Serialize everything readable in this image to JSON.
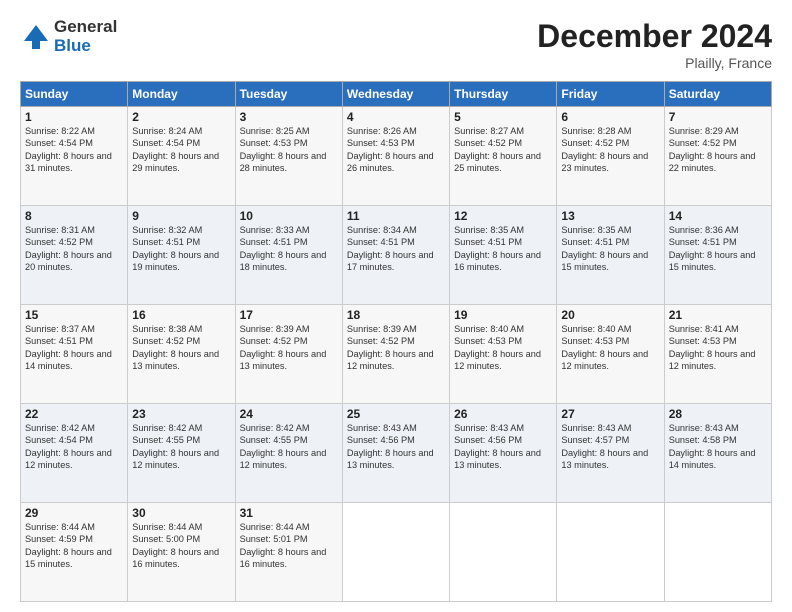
{
  "logo": {
    "general": "General",
    "blue": "Blue"
  },
  "title": "December 2024",
  "subtitle": "Plailly, France",
  "columns": [
    "Sunday",
    "Monday",
    "Tuesday",
    "Wednesday",
    "Thursday",
    "Friday",
    "Saturday"
  ],
  "weeks": [
    [
      {
        "day": "1",
        "rise": "Sunrise: 8:22 AM",
        "set": "Sunset: 4:54 PM",
        "daylight": "Daylight: 8 hours and 31 minutes."
      },
      {
        "day": "2",
        "rise": "Sunrise: 8:24 AM",
        "set": "Sunset: 4:54 PM",
        "daylight": "Daylight: 8 hours and 29 minutes."
      },
      {
        "day": "3",
        "rise": "Sunrise: 8:25 AM",
        "set": "Sunset: 4:53 PM",
        "daylight": "Daylight: 8 hours and 28 minutes."
      },
      {
        "day": "4",
        "rise": "Sunrise: 8:26 AM",
        "set": "Sunset: 4:53 PM",
        "daylight": "Daylight: 8 hours and 26 minutes."
      },
      {
        "day": "5",
        "rise": "Sunrise: 8:27 AM",
        "set": "Sunset: 4:52 PM",
        "daylight": "Daylight: 8 hours and 25 minutes."
      },
      {
        "day": "6",
        "rise": "Sunrise: 8:28 AM",
        "set": "Sunset: 4:52 PM",
        "daylight": "Daylight: 8 hours and 23 minutes."
      },
      {
        "day": "7",
        "rise": "Sunrise: 8:29 AM",
        "set": "Sunset: 4:52 PM",
        "daylight": "Daylight: 8 hours and 22 minutes."
      }
    ],
    [
      {
        "day": "8",
        "rise": "Sunrise: 8:31 AM",
        "set": "Sunset: 4:52 PM",
        "daylight": "Daylight: 8 hours and 20 minutes."
      },
      {
        "day": "9",
        "rise": "Sunrise: 8:32 AM",
        "set": "Sunset: 4:51 PM",
        "daylight": "Daylight: 8 hours and 19 minutes."
      },
      {
        "day": "10",
        "rise": "Sunrise: 8:33 AM",
        "set": "Sunset: 4:51 PM",
        "daylight": "Daylight: 8 hours and 18 minutes."
      },
      {
        "day": "11",
        "rise": "Sunrise: 8:34 AM",
        "set": "Sunset: 4:51 PM",
        "daylight": "Daylight: 8 hours and 17 minutes."
      },
      {
        "day": "12",
        "rise": "Sunrise: 8:35 AM",
        "set": "Sunset: 4:51 PM",
        "daylight": "Daylight: 8 hours and 16 minutes."
      },
      {
        "day": "13",
        "rise": "Sunrise: 8:35 AM",
        "set": "Sunset: 4:51 PM",
        "daylight": "Daylight: 8 hours and 15 minutes."
      },
      {
        "day": "14",
        "rise": "Sunrise: 8:36 AM",
        "set": "Sunset: 4:51 PM",
        "daylight": "Daylight: 8 hours and 15 minutes."
      }
    ],
    [
      {
        "day": "15",
        "rise": "Sunrise: 8:37 AM",
        "set": "Sunset: 4:51 PM",
        "daylight": "Daylight: 8 hours and 14 minutes."
      },
      {
        "day": "16",
        "rise": "Sunrise: 8:38 AM",
        "set": "Sunset: 4:52 PM",
        "daylight": "Daylight: 8 hours and 13 minutes."
      },
      {
        "day": "17",
        "rise": "Sunrise: 8:39 AM",
        "set": "Sunset: 4:52 PM",
        "daylight": "Daylight: 8 hours and 13 minutes."
      },
      {
        "day": "18",
        "rise": "Sunrise: 8:39 AM",
        "set": "Sunset: 4:52 PM",
        "daylight": "Daylight: 8 hours and 12 minutes."
      },
      {
        "day": "19",
        "rise": "Sunrise: 8:40 AM",
        "set": "Sunset: 4:53 PM",
        "daylight": "Daylight: 8 hours and 12 minutes."
      },
      {
        "day": "20",
        "rise": "Sunrise: 8:40 AM",
        "set": "Sunset: 4:53 PM",
        "daylight": "Daylight: 8 hours and 12 minutes."
      },
      {
        "day": "21",
        "rise": "Sunrise: 8:41 AM",
        "set": "Sunset: 4:53 PM",
        "daylight": "Daylight: 8 hours and 12 minutes."
      }
    ],
    [
      {
        "day": "22",
        "rise": "Sunrise: 8:42 AM",
        "set": "Sunset: 4:54 PM",
        "daylight": "Daylight: 8 hours and 12 minutes."
      },
      {
        "day": "23",
        "rise": "Sunrise: 8:42 AM",
        "set": "Sunset: 4:55 PM",
        "daylight": "Daylight: 8 hours and 12 minutes."
      },
      {
        "day": "24",
        "rise": "Sunrise: 8:42 AM",
        "set": "Sunset: 4:55 PM",
        "daylight": "Daylight: 8 hours and 12 minutes."
      },
      {
        "day": "25",
        "rise": "Sunrise: 8:43 AM",
        "set": "Sunset: 4:56 PM",
        "daylight": "Daylight: 8 hours and 13 minutes."
      },
      {
        "day": "26",
        "rise": "Sunrise: 8:43 AM",
        "set": "Sunset: 4:56 PM",
        "daylight": "Daylight: 8 hours and 13 minutes."
      },
      {
        "day": "27",
        "rise": "Sunrise: 8:43 AM",
        "set": "Sunset: 4:57 PM",
        "daylight": "Daylight: 8 hours and 13 minutes."
      },
      {
        "day": "28",
        "rise": "Sunrise: 8:43 AM",
        "set": "Sunset: 4:58 PM",
        "daylight": "Daylight: 8 hours and 14 minutes."
      }
    ],
    [
      {
        "day": "29",
        "rise": "Sunrise: 8:44 AM",
        "set": "Sunset: 4:59 PM",
        "daylight": "Daylight: 8 hours and 15 minutes."
      },
      {
        "day": "30",
        "rise": "Sunrise: 8:44 AM",
        "set": "Sunset: 5:00 PM",
        "daylight": "Daylight: 8 hours and 16 minutes."
      },
      {
        "day": "31",
        "rise": "Sunrise: 8:44 AM",
        "set": "Sunset: 5:01 PM",
        "daylight": "Daylight: 8 hours and 16 minutes."
      },
      null,
      null,
      null,
      null
    ]
  ]
}
